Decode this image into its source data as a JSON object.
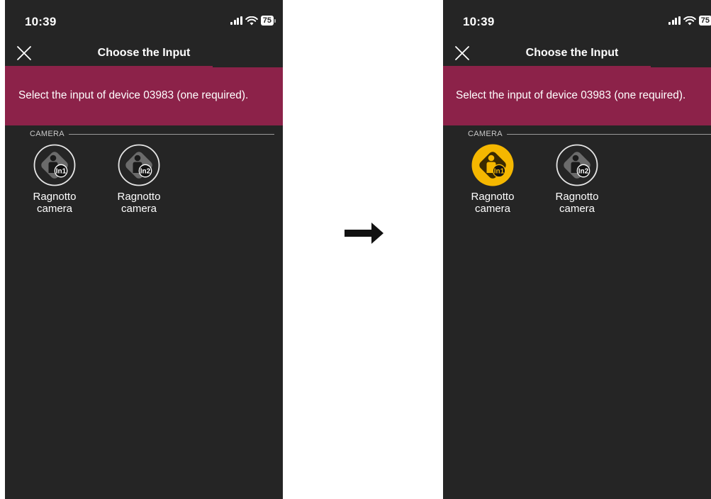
{
  "status_bar": {
    "time": "10:39",
    "battery": "75"
  },
  "header": {
    "title": "Choose the Input"
  },
  "banner": {
    "text": "Select the input of device 03983 (one required)."
  },
  "section": {
    "label": "CAMERA"
  },
  "inputs": [
    {
      "label_line1": "Ragnotto",
      "label_line2": "camera",
      "badge": "In1"
    },
    {
      "label_line1": "Ragnotto",
      "label_line2": "camera",
      "badge": "In2"
    }
  ],
  "states": {
    "before_selected": "none",
    "after_selected": "In1"
  },
  "colors": {
    "accent": "#8c2249",
    "background": "#252525",
    "selected": "#f5b700"
  },
  "icons": [
    "signal-icon",
    "wifi-icon",
    "battery-icon",
    "close-icon",
    "camera-input-icon",
    "arrow-right-icon"
  ]
}
